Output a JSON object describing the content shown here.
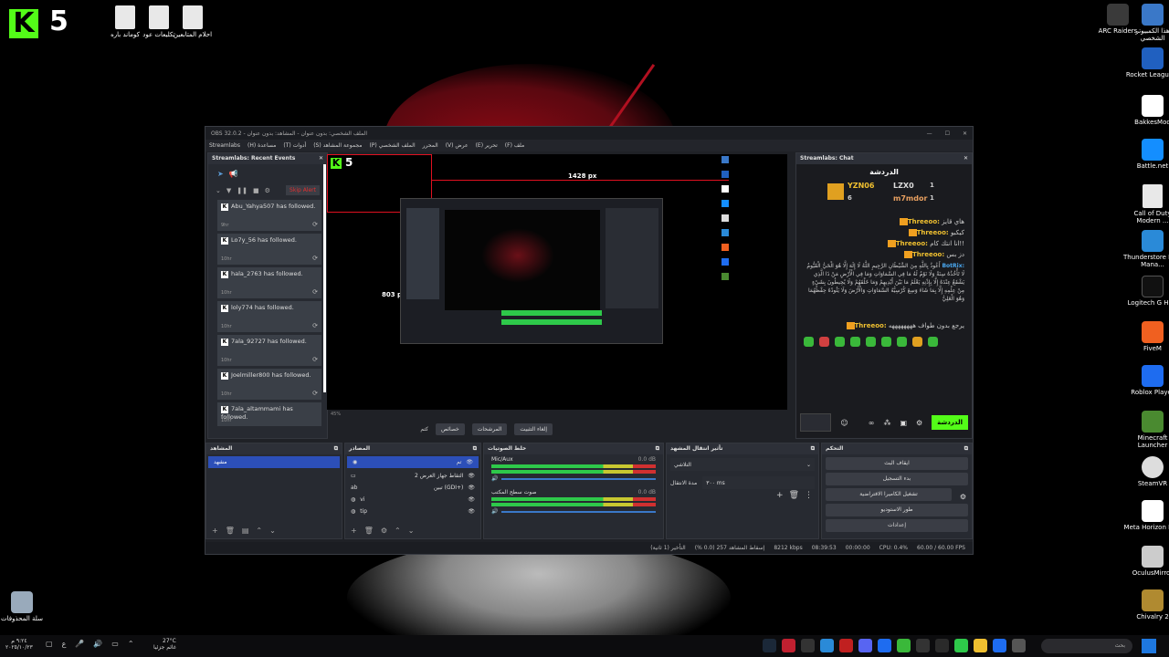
{
  "desktop": {
    "logo_letter": "K",
    "logo_number": "5",
    "files": [
      {
        "label": "كوماند باره"
      },
      {
        "label": "تكليعات عود"
      },
      {
        "label": "احلام المتابعين"
      }
    ],
    "right_icons": [
      {
        "label": "ARC Raiders"
      },
      {
        "label": "هذا الكمبيوتر الشخصي"
      },
      {
        "label": "Rocket League®"
      },
      {
        "label": "BakkesMod"
      },
      {
        "label": "Battle.net"
      },
      {
        "label": "Call of Duty Modern ..."
      },
      {
        "label": "Thunderstore Mod Mana..."
      },
      {
        "label": "Logitech G HUB"
      },
      {
        "label": "FiveM"
      },
      {
        "label": "Roblox Player"
      },
      {
        "label": "Minecraft Launcher"
      },
      {
        "label": "SteamVR"
      },
      {
        "label": "Meta Horizon Link"
      },
      {
        "label": "OculusMirror"
      },
      {
        "label": "Chivalry 2"
      }
    ],
    "recycle_label": "سلة المحذوفات"
  },
  "obs": {
    "title": "OBS 32.0.2 - الملف الشخصي: بدون عنوان - المشاهد: بدون عنوان",
    "menu": [
      "ملف (F)",
      "تحرير (E)",
      "عرض (V)",
      "المحرر",
      "الملف الشخصي (P)",
      "مجموعة المشاهد (S)",
      "أدوات (T)",
      "مساعدة (H)",
      "Streamlabs"
    ],
    "events_dock": {
      "title": "Streamlabs: Recent Events",
      "skip_label": "Skip Alert",
      "events": [
        {
          "text": "Abu_Yahya507 has followed.",
          "time": "9hr"
        },
        {
          "text": "Lo7y_56 has followed.",
          "time": "10hr"
        },
        {
          "text": "hala_2763 has followed.",
          "time": "10hr"
        },
        {
          "text": "loly774 has followed.",
          "time": "10hr"
        },
        {
          "text": "7ala_92727 has followed.",
          "time": "10hr"
        },
        {
          "text": "Joelmiller800 has followed.",
          "time": "10hr"
        },
        {
          "text": "7ala_altammami has followed.",
          "time": "10hr"
        }
      ]
    },
    "preview": {
      "dim_w": "1428 px",
      "dim_h": "803 px"
    },
    "preview_toolbar": {
      "zoom": "45%",
      "buttons": [
        "إلغاء التثبيت",
        "المرشحات",
        "خصائص",
        "كتم"
      ]
    },
    "chat_dock": {
      "title": "Streamlabs: Chat",
      "header": "الدردشة",
      "leaders": [
        {
          "name": "YZN06",
          "count": "6"
        },
        {
          "name": "LZX0",
          "count": "1"
        },
        {
          "name": "m7mdor",
          "count": "1"
        }
      ],
      "messages": [
        {
          "user": "Threeoo:",
          "text": "هاي قايز"
        },
        {
          "user": "Threeoo:",
          "text": "كيكبو"
        },
        {
          "user": "Threeoo:",
          "text": "!!انا انتك كام"
        },
        {
          "user": "Threeoo:",
          "text": "دز بس"
        },
        {
          "user": "BotRix:",
          "text": "أَعُوذُ بِاللَّهِ مِنَ الشَّيْطَانِ الرَّجِيمِ اللَّهُ لَا إِلَهَ إِلَّا هُوَ الْحَيُّ الْقَيُّومُ لَا تَأْخُذُهُ سِنَةٌ وَلَا نَوْمٌ لَهُ مَا فِي السَّمَاوَاتِ وَمَا فِي الْأَرْضِ مَنْ ذَا الَّذِي يَشْفَعُ عِنْدَهُ إِلَّا بِإِذْنِهِ يَعْلَمُ مَا بَيْنَ أَيْدِيهِمْ وَمَا خَلْفَهُمْ وَلَا يُحِيطُونَ بِشَيْءٍ مِنْ عِلْمِهِ إِلَّا بِمَا شَاءَ وَسِعَ كُرْسِيُّهُ السَّمَاوَاتِ وَالْأَرْضَ وَلَا يَئُودُهُ حِفْظُهُمَا وَهُوَ الْعَلِيُّ"
        },
        {
          "user": "Threeoo:",
          "text": "يرجع بدون طواف ههههههههه"
        }
      ],
      "send_label": "الدردشة"
    },
    "scenes": {
      "title": "المشاهد",
      "items": [
        "مشهد"
      ]
    },
    "sources": {
      "title": "المصادر",
      "items": [
        "تم",
        "التقاط جهاز العرض 2",
        "تبين (GDI+)",
        "vi",
        "tip"
      ]
    },
    "mixer": {
      "title": "خلط الصوتيات",
      "channels": [
        {
          "name": "Mic/Aux",
          "db": "0.0 dB"
        },
        {
          "name": "صوت سطح المكتب",
          "db": "0.0 dB"
        }
      ]
    },
    "transitions": {
      "title": "تأثير انتقال المشهد",
      "type": "التلاشي",
      "duration_label": "مدة الانتقال",
      "duration": "٣٠٠ ms"
    },
    "controls": {
      "title": "التحكم",
      "buttons": [
        "ايقاف البث",
        "بدء التسجيل",
        "تشغيل الكاميرا الافتراضية",
        "طور الاستوديو",
        "إعدادات"
      ]
    },
    "status": {
      "delay": "التأخير (1 ثانية)",
      "dropped": "إسقاط المشاهد 257 (0.0 %)",
      "bitrate": "8212 kbps",
      "live_time": "08:39:53",
      "rec_time": "00:00:00",
      "cpu": "CPU: 0.4%",
      "fps": "60.00 / 60.00 FPS"
    }
  },
  "taskbar": {
    "weather_temp": "27°C",
    "weather_desc": "غائم جزئيا",
    "clock_time": "٩:٢٤ م",
    "clock_date": "٢٠٢٥/١٠/٢٣",
    "lang": "ع",
    "search_placeholder": "بحث"
  }
}
